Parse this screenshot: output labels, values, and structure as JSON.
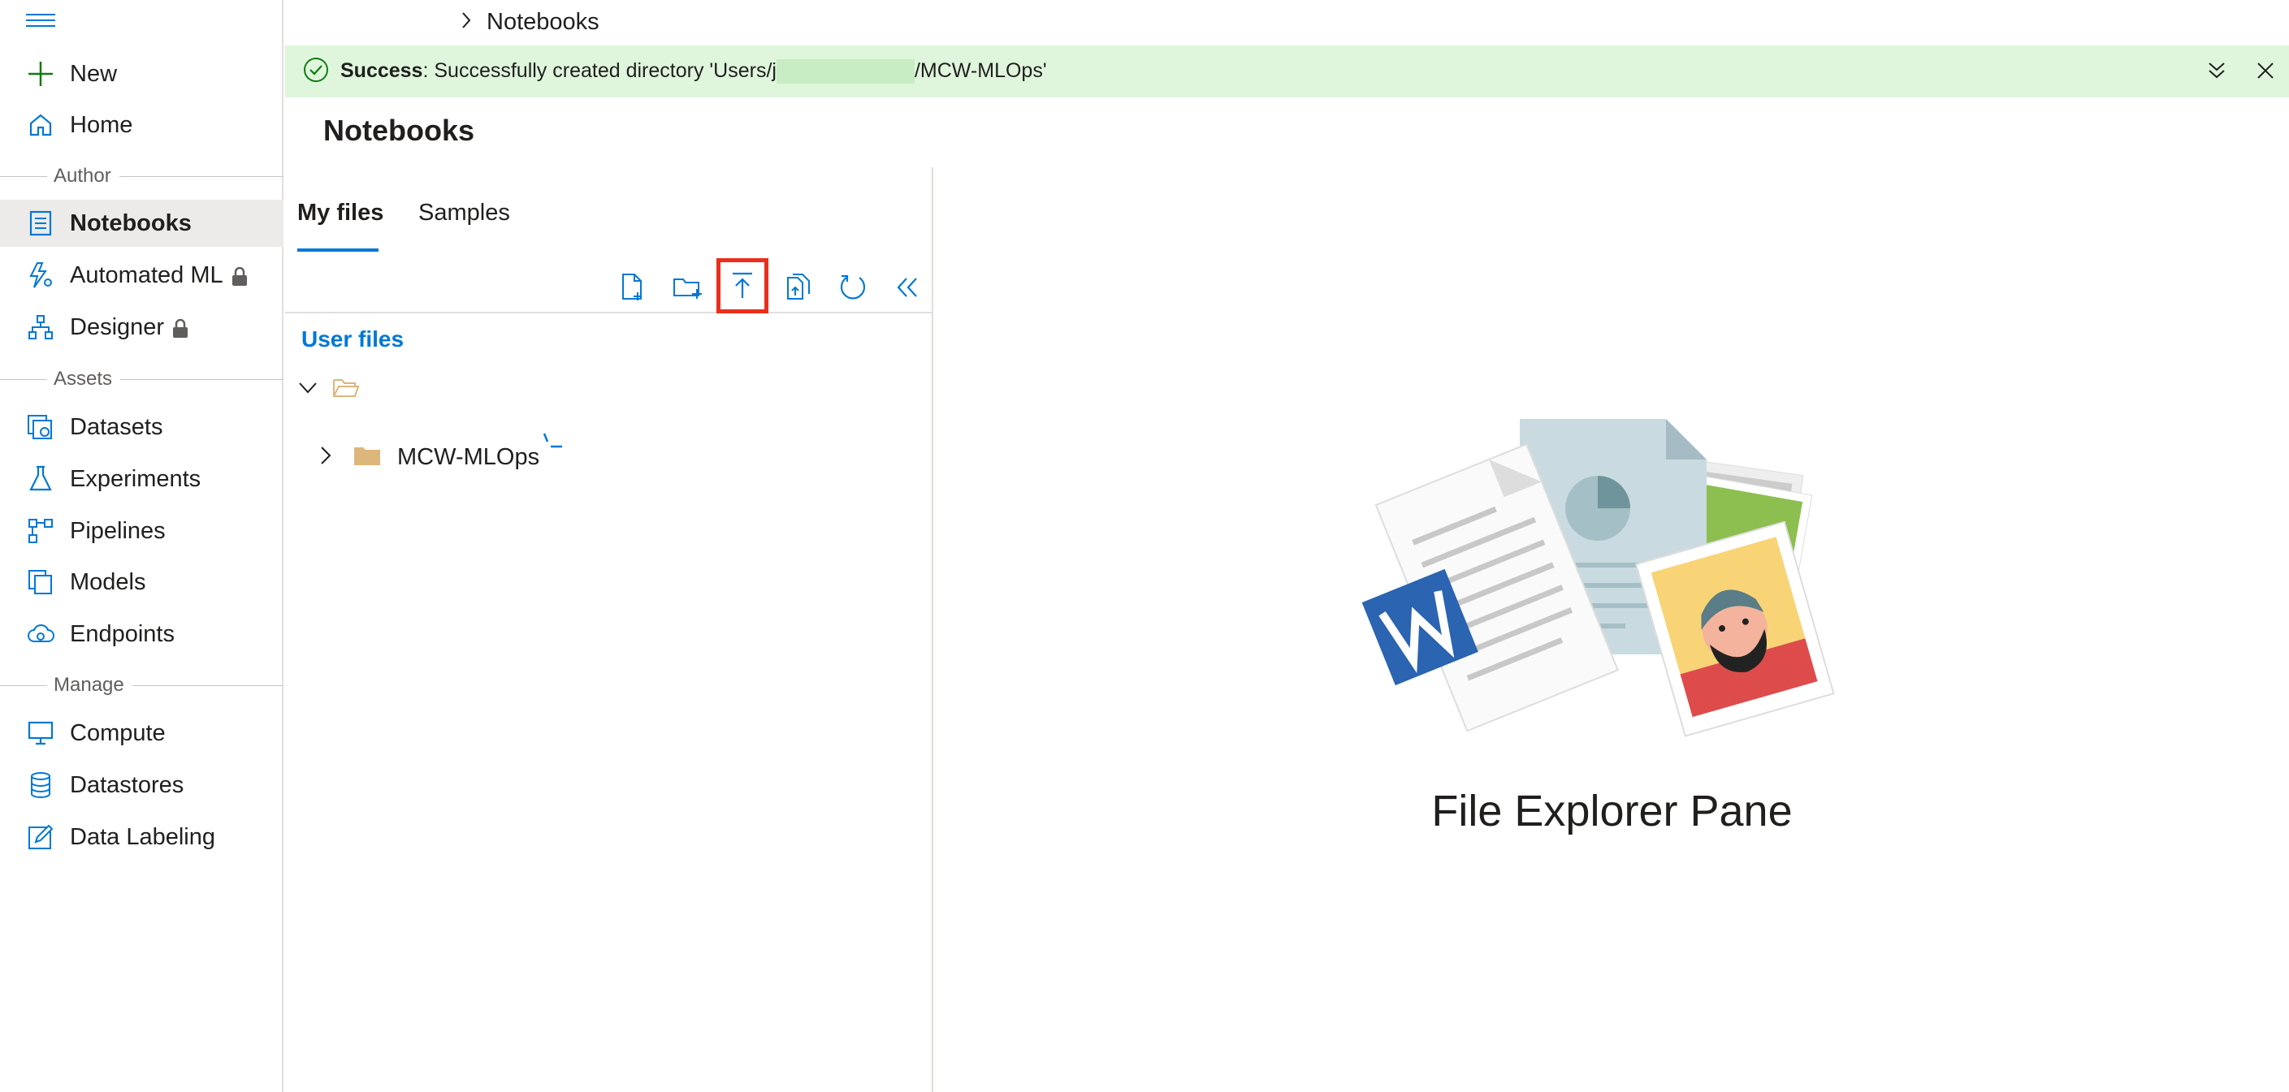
{
  "sidebar": {
    "menu_icon": "hamburger-icon",
    "items": [
      {
        "label": "New",
        "icon": "plus-icon"
      },
      {
        "label": "Home",
        "icon": "home-icon"
      },
      {
        "label": "Notebooks",
        "icon": "notebook-icon",
        "active": true
      },
      {
        "label": "Automated ML",
        "icon": "automl-icon",
        "locked": true
      },
      {
        "label": "Designer",
        "icon": "designer-icon",
        "locked": true
      },
      {
        "label": "Datasets",
        "icon": "datasets-icon"
      },
      {
        "label": "Experiments",
        "icon": "flask-icon"
      },
      {
        "label": "Pipelines",
        "icon": "pipeline-icon"
      },
      {
        "label": "Models",
        "icon": "models-icon"
      },
      {
        "label": "Endpoints",
        "icon": "cloud-endpoint-icon"
      },
      {
        "label": "Compute",
        "icon": "monitor-icon"
      },
      {
        "label": "Datastores",
        "icon": "database-icon"
      },
      {
        "label": "Data Labeling",
        "icon": "edit-icon"
      }
    ],
    "sections": {
      "author": "Author",
      "assets": "Assets",
      "manage": "Manage"
    }
  },
  "breadcrumb": {
    "current": "Notebooks"
  },
  "banner": {
    "status": "Success",
    "message_prefix": ": Successfully created directory 'Users/j",
    "message_suffix": "/MCW-MLOps'"
  },
  "page": {
    "title": "Notebooks"
  },
  "tabs": [
    {
      "label": "My files",
      "active": true
    },
    {
      "label": "Samples",
      "active": false
    }
  ],
  "file_tree": {
    "heading": "User files",
    "items": [
      {
        "label": "MCW-MLOps",
        "type": "folder",
        "expanded": false,
        "loading": true
      }
    ]
  },
  "toolbar": {
    "buttons": [
      "new-file-icon",
      "new-folder-icon",
      "upload-icon",
      "upload-folder-icon",
      "refresh-icon",
      "collapse-icon"
    ],
    "highlighted": "upload-icon"
  },
  "right_pane": {
    "caption": "File Explorer Pane"
  },
  "colors": {
    "accent": "#0078d4",
    "success_bg": "#dff6dd",
    "success_icon": "#107c10",
    "highlight": "#e82f1e",
    "folder": "#dcb67a"
  }
}
